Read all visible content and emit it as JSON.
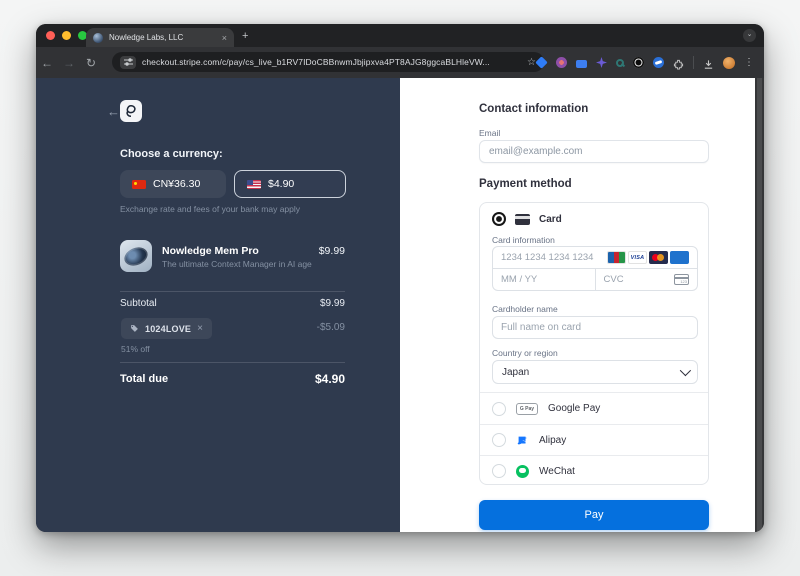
{
  "browser": {
    "tab": {
      "title": "Nowledge Labs, LLC",
      "close_glyph": "×"
    },
    "new_tab_glyph": "+",
    "nav": {
      "back": "←",
      "forward": "→",
      "reload": "↻"
    },
    "url": "checkout.stripe.com/c/pay/cs_live_b1RV7IDoCBBnwmJbjipxva4PT8AJG8ggcaBLHleVW...",
    "bookmark_glyph": "☆",
    "menu_glyph": "⋮"
  },
  "summary": {
    "back_glyph": "←",
    "choose_currency_label": "Choose a currency:",
    "currencies": [
      {
        "label": "CN¥36.30",
        "flag": "china",
        "selected": false
      },
      {
        "label": "$4.90",
        "flag": "us",
        "selected": true
      }
    ],
    "exchange_note": "Exchange rate and fees of your bank may apply",
    "product": {
      "name": "Nowledge Mem Pro",
      "description": "The ultimate Context Manager in AI age",
      "price": "$9.99"
    },
    "subtotal_label": "Subtotal",
    "subtotal_value": "$9.99",
    "coupon": {
      "code": "1024LOVE",
      "remove_glyph": "×",
      "discount": "-$5.09",
      "note": "51% off"
    },
    "total_label": "Total due",
    "total_value": "$4.90"
  },
  "form": {
    "contact_heading": "Contact information",
    "email_label": "Email",
    "email_placeholder": "email@example.com",
    "payment_heading": "Payment method",
    "card_option_label": "Card",
    "card_information_label": "Card information",
    "card_number_placeholder": "1234 1234 1234 1234",
    "card_brands": [
      "JCB",
      "VISA",
      "Mastercard",
      "AMEX"
    ],
    "expiry_placeholder": "MM / YY",
    "cvc_placeholder": "CVC",
    "cardholder_label": "Cardholder name",
    "cardholder_placeholder": "Full name on card",
    "country_label": "Country or region",
    "country_value": "Japan",
    "payment_options": [
      {
        "label": "Google Pay",
        "badge": "G Pay"
      },
      {
        "label": "Alipay"
      },
      {
        "label": "WeChat"
      }
    ],
    "pay_button_label": "Pay"
  },
  "colors": {
    "accent_blue": "#0570de",
    "panel_navy": "#2f3a4e",
    "brand_white": "#ffffff"
  }
}
